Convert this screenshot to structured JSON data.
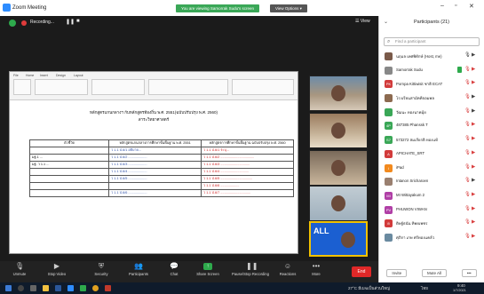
{
  "titlebar": {
    "app": "Zoom Meeting",
    "banner": "You are viewing Samorrak Sudu's screen",
    "view_options": "View Options ▾"
  },
  "topbar": {
    "recording": "Recording...",
    "view": "☰ View"
  },
  "doc": {
    "title1": "หลักสูตรแกนกลางฯ กับหลักสูตรท้องถิ่น พ.ศ. 2551(ฉบับปรับปรุง พ.ศ. 2560)",
    "title2": "สาระวิทยาศาสตร์",
    "headers": [
      "ตัวชี้วัด",
      "หลักสูตรแกนกลางการศึกษาขั้นพื้นฐาน พ.ศ. 2551",
      "หลักสูตรการศึกษาขั้นพื้นฐาน ฉบับปรับปรุง พ.ศ. 2560"
    ],
    "rows": [
      [
        "",
        "ว 1.1 ป.6/1 อธิบาย...",
        "ว 1.1 ป.6/1 ระบุ..."
      ],
      [
        "มฐ.1 ...",
        "ว 1.1 ป.6/2 ....................",
        "ว 1.1 ป.6/2 ...................................."
      ],
      [
        "มฐ. ว 1.1 ...",
        "ว 1.1 ป.6/3 ....................",
        "ว 1.1 ป.6/3 ..............................."
      ],
      [
        "",
        "ว 1.1 ป.6/4 ....................",
        "ว 1.1 ป.6/4 .............................."
      ],
      [
        "",
        "ว 1.1 ป.6/5 ....................",
        "ว 1.1 ป.6/5 .................................."
      ],
      [
        "",
        "",
        "ว 1.1 ป.6/6 ...................."
      ],
      [
        "",
        "ว 1.1 ป.6/6 ....................",
        "ว 1.1 ป.6/7 ................................"
      ]
    ]
  },
  "thumbs": [
    {
      "caption": ""
    },
    {
      "caption": ""
    },
    {
      "caption": ""
    },
    {
      "caption": ""
    },
    {
      "caption": "ALL"
    }
  ],
  "toolbar": {
    "items": [
      "Unmute",
      "Stop Video",
      "Security",
      "Participants",
      "Chat",
      "Share Screen",
      "Pause/Stop Recording",
      "Reactions",
      "More"
    ],
    "participants_count": "21",
    "end": "End"
  },
  "panel": {
    "title": "Participants (21)",
    "search_placeholder": "Find a participant",
    "participants": [
      {
        "name": "นฤมล เทศพิทักษ์ (Host, me)",
        "initials": "",
        "color": "#7a5a4a"
      },
      {
        "name": "Samorrak Sudu",
        "initials": "",
        "color": "#888888"
      },
      {
        "name": "Pornpa Kittiwisit ชาติ ECAT",
        "initials": "PK",
        "color": "#d23b3b"
      },
      {
        "name": "โรงเรียนสามัคคีจอมพล",
        "initials": "",
        "color": "#8c6a50"
      },
      {
        "name": "วัฒนะ  ทองนาคมุ้ย",
        "initials": "",
        "color": "#3aa757"
      },
      {
        "name": "487385 Phanssk T",
        "initials": "4P",
        "color": "#3aa757"
      },
      {
        "name": "573272 สมเกียรติ ทองแท้",
        "initials": "S7",
        "color": "#3aa757"
      },
      {
        "name": "APICHATE_SRT",
        "initials": "A",
        "color": "#d23b3b"
      },
      {
        "name": "iPad",
        "initials": "i",
        "color": "#f28a1e"
      },
      {
        "name": "Intanon Sricharoen",
        "initials": "",
        "color": "#9a8070"
      },
      {
        "name": "MI Wittayakum 2",
        "initials": "MI",
        "color": "#b03fa6"
      },
      {
        "name": "PHUWON VIWAN",
        "initials": "PV",
        "color": "#b03fa6"
      },
      {
        "name": "ดิษฐ์ธนัน ทิพยเพชร",
        "initials": "ด",
        "color": "#d23b3b"
      },
      {
        "name": "ศุภิกา เกษ  ศรีทองแคล้ว",
        "initials": "",
        "color": "#6a8aa0"
      }
    ],
    "invite": "Invite",
    "mute_all": "Mute All"
  },
  "taskbar": {
    "weather": "27°C มีเมฆเป็นส่วนใหญ่",
    "lang": "ไทย",
    "time": "9:40",
    "date": "1/7/2021"
  }
}
